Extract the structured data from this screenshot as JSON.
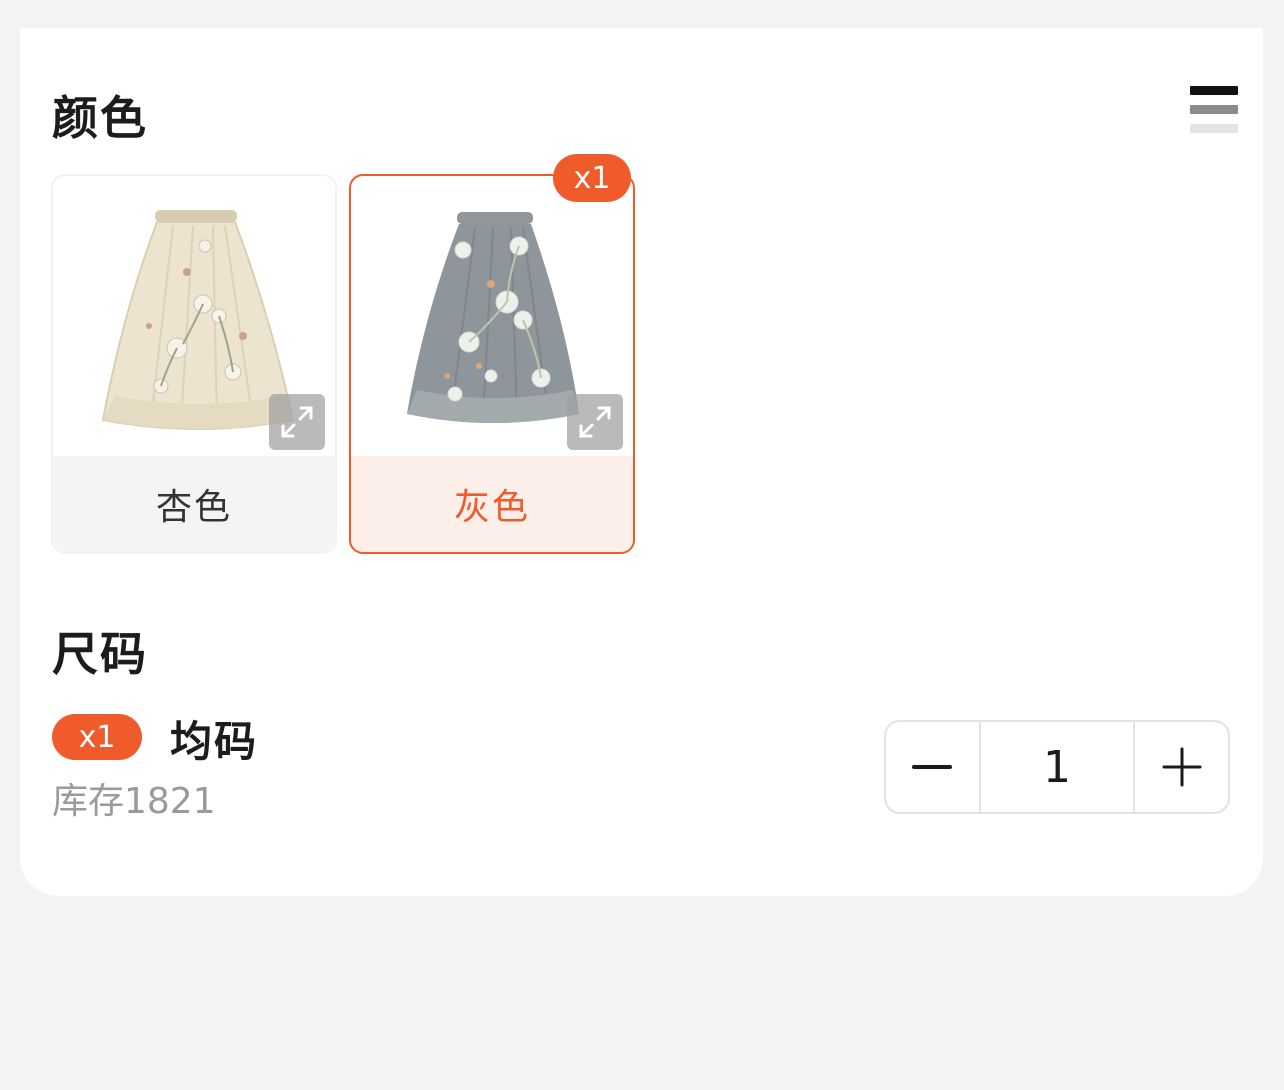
{
  "color_section": {
    "title": "颜色",
    "options": [
      {
        "name": "杏色",
        "selected": false,
        "badge": ""
      },
      {
        "name": "灰色",
        "selected": true,
        "badge": "x1"
      }
    ]
  },
  "size_section": {
    "title": "尺码",
    "items": [
      {
        "badge": "x1",
        "name": "均码",
        "stock": "库存1821",
        "quantity": "1"
      }
    ]
  },
  "icons": {
    "view_toggle": "list-view-icon",
    "expand": "expand-icon",
    "minus": "minus-icon",
    "plus": "plus-icon"
  },
  "colors": {
    "accent": "#ef5b2b",
    "accent_light": "#fcefea",
    "page_bg": "#f3f3f3"
  }
}
